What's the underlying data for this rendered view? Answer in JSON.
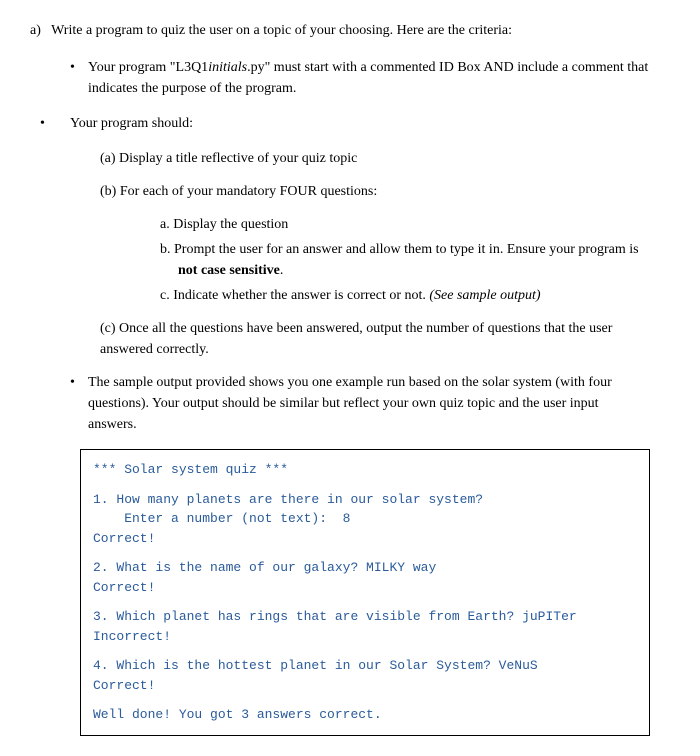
{
  "header": {
    "label": "a)",
    "text": "Write a program to quiz the user on a topic of your choosing.  Here are the criteria:"
  },
  "bullet1": {
    "part1": "Your program \"L3Q1",
    "italic": "initials",
    "part2": ".py\" must start with a commented ID Box AND include a comment that indicates the purpose of the program."
  },
  "bullet2": {
    "intro": "Your program should:",
    "a": "(a)  Display a title reflective of your quiz topic",
    "b": "(b)  For each of your mandatory FOUR questions:",
    "inner_a": "a.   Display the question",
    "inner_b_pre": "b.   Prompt the user for an answer and allow them to type it in.  Ensure your program is ",
    "inner_b_bold": "not case sensitive",
    "inner_b_post": ".",
    "inner_c_pre": "c.   Indicate whether the answer is correct or not.  ",
    "inner_c_italic": "(See sample output)",
    "c": "(c)  Once all the questions have been answered, output the number of questions that the user answered correctly."
  },
  "bullet3": "The sample output provided shows you one example run based on the solar system (with four questions).  Your output should be similar but reflect your own quiz topic and the user input answers.",
  "sample": {
    "title": "*** Solar system quiz ***",
    "q1_line1": "1.  How many planets are there in our solar system?",
    "q1_line2": "    Enter a number (not text):  8",
    "q1_result": "Correct!",
    "q2_line1": "2.  What is the name of our galaxy? MILKY way",
    "q2_result": "Correct!",
    "q3_line1": "3.  Which planet has rings that are visible from Earth? juPITer",
    "q3_result": "Incorrect!",
    "q4_line1": "4.  Which is the hottest planet in our Solar System? VeNuS",
    "q4_result": "Correct!",
    "final": "Well done!  You got 3 answers correct."
  }
}
